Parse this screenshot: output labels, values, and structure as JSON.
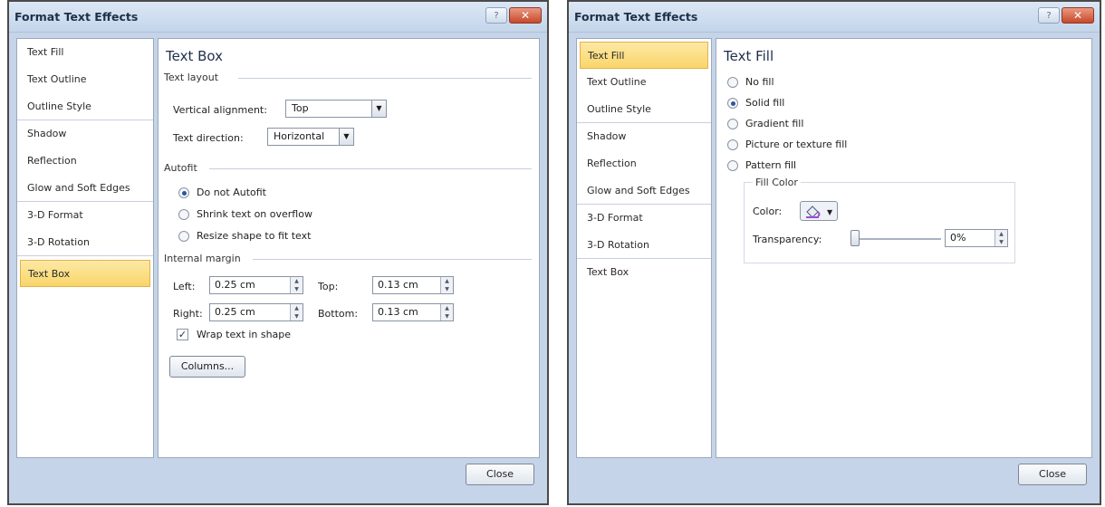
{
  "left_dialog": {
    "title": "Format Text Effects",
    "help_label": "?",
    "close_x": "✕",
    "nav": [
      "Text Fill",
      "Text Outline",
      "Outline Style",
      "Shadow",
      "Reflection",
      "Glow and Soft Edges",
      "3-D Format",
      "3-D Rotation",
      "Text Box"
    ],
    "selected_nav": "Text Box",
    "panel_title": "Text Box",
    "text_layout": {
      "group": "Text layout",
      "vertical_alignment_label": "Vertical alignment:",
      "vertical_alignment_value": "Top",
      "text_direction_label": "Text direction:",
      "text_direction_value": "Horizontal"
    },
    "autofit": {
      "group": "Autofit",
      "options": [
        "Do not Autofit",
        "Shrink text on overflow",
        "Resize shape to fit text"
      ],
      "selected": "Do not Autofit"
    },
    "internal_margin": {
      "group": "Internal margin",
      "left_label": "Left:",
      "left_value": "0.25 cm",
      "right_label": "Right:",
      "right_value": "0.25 cm",
      "top_label": "Top:",
      "top_value": "0.13 cm",
      "bottom_label": "Bottom:",
      "bottom_value": "0.13 cm",
      "wrap_label": "Wrap text in shape",
      "wrap_checked": true
    },
    "columns_button": "Columns...",
    "close_button": "Close"
  },
  "right_dialog": {
    "title": "Format Text Effects",
    "help_label": "?",
    "close_x": "✕",
    "nav": [
      "Text Fill",
      "Text Outline",
      "Outline Style",
      "Shadow",
      "Reflection",
      "Glow and Soft Edges",
      "3-D Format",
      "3-D Rotation",
      "Text Box"
    ],
    "selected_nav": "Text Fill",
    "panel_title": "Text Fill",
    "fill_options": [
      "No fill",
      "Solid fill",
      "Gradient fill",
      "Picture or texture fill",
      "Pattern fill"
    ],
    "selected_fill": "Solid fill",
    "fill_color": {
      "group": "Fill Color",
      "color_label": "Color:",
      "transparency_label": "Transparency:",
      "transparency_value": "0%",
      "transparency_level": 0
    },
    "close_button": "Close"
  },
  "colors": {
    "dialog_bg": "#c5d4e8",
    "selected_nav_bg": "#f9d56a",
    "close_x_bg": "#c9482a"
  }
}
